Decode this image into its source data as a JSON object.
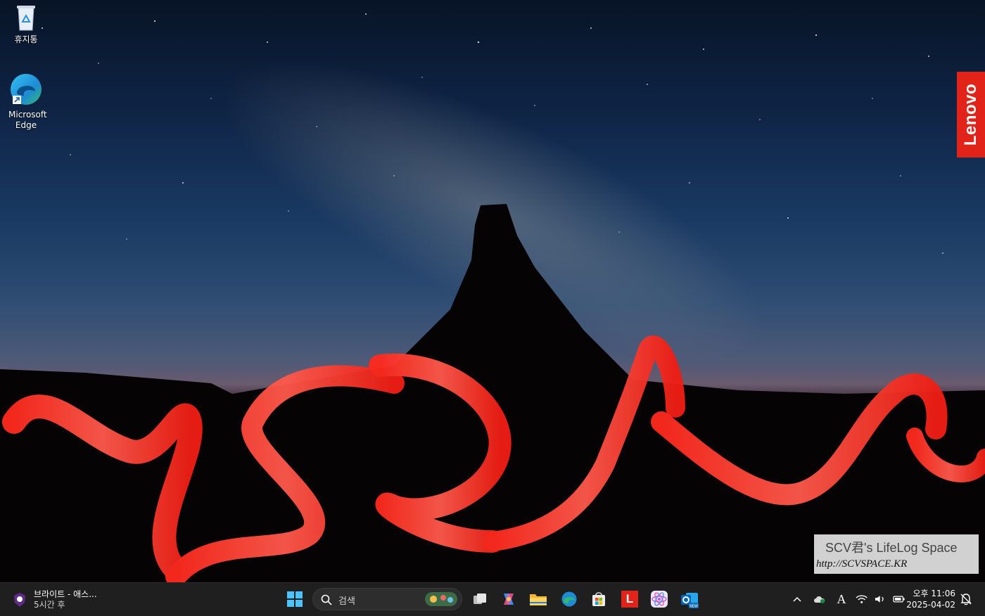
{
  "desktop": {
    "icons": [
      {
        "label": "휴지통",
        "icon": "recycle-bin-icon"
      },
      {
        "label": "Microsoft Edge",
        "icon": "edge-icon"
      }
    ],
    "brand_badge": "Lenovo",
    "watermark": {
      "title": "SCV君's LifeLog Space",
      "url": "http://SCVSPACE.KR"
    }
  },
  "taskbar": {
    "widget": {
      "title": "브라이트 - 애스...",
      "subtitle": "5시간 후",
      "icon": "sports-team-icon"
    },
    "search_placeholder": "검색",
    "apps": [
      {
        "name": "start",
        "icon": "windows-start-icon"
      },
      {
        "name": "task-view",
        "icon": "task-view-icon"
      },
      {
        "name": "copilot",
        "icon": "copilot-icon"
      },
      {
        "name": "file-explorer",
        "icon": "folder-icon"
      },
      {
        "name": "edge",
        "icon": "edge-icon"
      },
      {
        "name": "microsoft-store",
        "icon": "store-icon"
      },
      {
        "name": "lenovo-app",
        "icon": "lenovo-l-icon",
        "label": "L"
      },
      {
        "name": "atom-app",
        "icon": "atom-icon"
      },
      {
        "name": "outlook-new",
        "icon": "outlook-icon",
        "badge": "NEW"
      }
    ],
    "tray": {
      "ime": "A",
      "time": "오후 11:06",
      "date": "2025-04-02"
    }
  },
  "colors": {
    "accent_red": "#e2231a",
    "taskbar_bg": "#1f1f1f"
  }
}
